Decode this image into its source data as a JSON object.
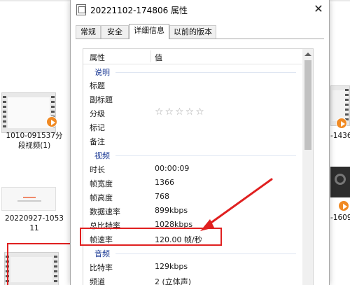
{
  "dialog": {
    "title": "20221102-174806 属性",
    "close_label": "✕",
    "tabs": [
      "常规",
      "安全",
      "详细信息",
      "以前的版本"
    ],
    "active_tab": "详细信息"
  },
  "table": {
    "col_property": "属性",
    "col_value": "值",
    "groups": {
      "description": "说明",
      "video": "视频",
      "audio": "音频"
    },
    "description_rows": [
      {
        "key": "标题",
        "value": ""
      },
      {
        "key": "副标题",
        "value": ""
      },
      {
        "key": "分级",
        "value": ""
      },
      {
        "key": "标记",
        "value": ""
      },
      {
        "key": "备注",
        "value": ""
      }
    ],
    "rating_stars": "☆☆☆☆☆",
    "video_rows": [
      {
        "key": "时长",
        "value": "00:00:09"
      },
      {
        "key": "帧宽度",
        "value": "1366"
      },
      {
        "key": "帧高度",
        "value": "768"
      },
      {
        "key": "数据速率",
        "value": "899kbps"
      },
      {
        "key": "总比特率",
        "value": "1028kbps"
      },
      {
        "key": "帧速率",
        "value": "120.00 帧/秒"
      }
    ],
    "audio_rows": [
      {
        "key": "比特率",
        "value": "129kbps"
      },
      {
        "key": "频道",
        "value": "2 (立体声)"
      }
    ]
  },
  "explorer": {
    "files": [
      {
        "name_line1": "1010-091537分",
        "name_line2": "段视频(1)"
      },
      {
        "name_line1": "20220927-1053",
        "name_line2": "11"
      },
      {
        "name_line1": "-1436",
        "name_line2": ""
      },
      {
        "name_line1": "-1609",
        "name_line2": ""
      }
    ]
  },
  "colors": {
    "highlight_red": "#e02020",
    "group_blue": "#1e3c96",
    "play_badge_orange": "#f08a24"
  }
}
